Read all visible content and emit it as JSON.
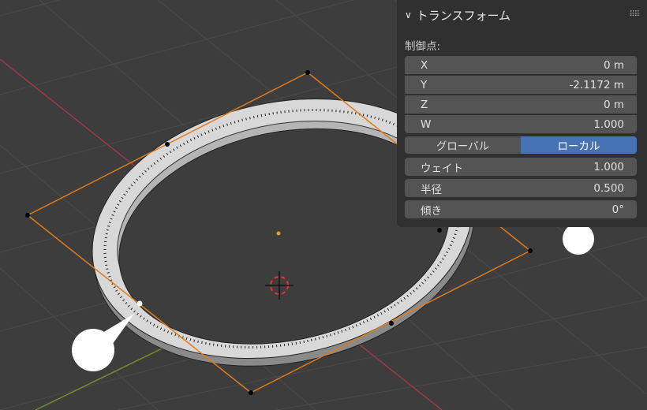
{
  "panel": {
    "title": "トランスフォーム",
    "section_label": "制御点:",
    "fields": [
      {
        "label": "X",
        "value": "0 m"
      },
      {
        "label": "Y",
        "value": "-2.1172 m"
      },
      {
        "label": "Z",
        "value": "0 m"
      },
      {
        "label": "W",
        "value": "1.000"
      }
    ],
    "space_toggle": {
      "options": [
        "グローバル",
        "ローカル"
      ],
      "selected": "ローカル"
    },
    "weight": {
      "label": "ウェイト",
      "value": "1.000"
    },
    "radius": {
      "label": "半径",
      "value": "0.500"
    },
    "tilt": {
      "label": "傾き",
      "value": "0°"
    }
  },
  "colors": {
    "accent": "#4772b3",
    "x_axis": "#9b3a48",
    "y_axis": "#6a8f2b",
    "control": "#e07b1a"
  }
}
